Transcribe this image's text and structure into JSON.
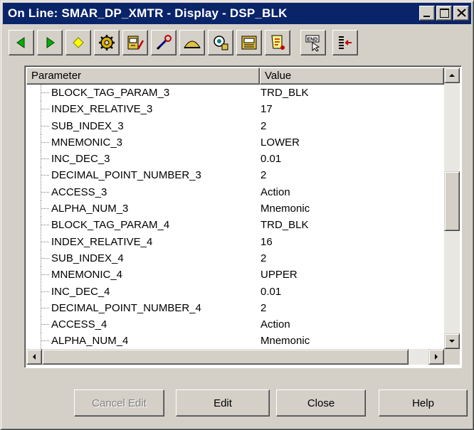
{
  "window": {
    "title": "On Line: SMAR_DP_XMTR - Display - DSP_BLK",
    "controls": [
      "minimize-icon",
      "maximize-icon",
      "close-icon"
    ]
  },
  "toolbar": {
    "buttons": [
      {
        "icon": "arrow-left-icon",
        "color": "#00a000"
      },
      {
        "icon": "arrow-right-icon",
        "color": "#00a000"
      },
      {
        "icon": "diamond-icon",
        "color": "#ffff00"
      },
      {
        "icon": "gears-icon"
      },
      {
        "icon": "calibrate-icon"
      },
      {
        "icon": "wrench-icon"
      },
      {
        "icon": "mountain-icon"
      },
      {
        "icon": "block-view-icon"
      },
      {
        "icon": "monitor-icon"
      },
      {
        "icon": "scroll-icon"
      },
      {
        "icon": "end-icon",
        "label": "END"
      },
      {
        "icon": "exit-list-icon"
      }
    ]
  },
  "table": {
    "columns": [
      "Parameter",
      "Value"
    ],
    "rows": [
      {
        "parameter": "BLOCK_TAG_PARAM_3",
        "value": "TRD_BLK"
      },
      {
        "parameter": "INDEX_RELATIVE_3",
        "value": "17"
      },
      {
        "parameter": "SUB_INDEX_3",
        "value": "2"
      },
      {
        "parameter": "MNEMONIC_3",
        "value": "LOWER"
      },
      {
        "parameter": "INC_DEC_3",
        "value": "0.01"
      },
      {
        "parameter": "DECIMAL_POINT_NUMBER_3",
        "value": "2"
      },
      {
        "parameter": "ACCESS_3",
        "value": "Action"
      },
      {
        "parameter": "ALPHA_NUM_3",
        "value": "Mnemonic"
      },
      {
        "parameter": "BLOCK_TAG_PARAM_4",
        "value": "TRD_BLK"
      },
      {
        "parameter": "INDEX_RELATIVE_4",
        "value": "16"
      },
      {
        "parameter": "SUB_INDEX_4",
        "value": "2"
      },
      {
        "parameter": "MNEMONIC_4",
        "value": "UPPER"
      },
      {
        "parameter": "INC_DEC_4",
        "value": "0.01"
      },
      {
        "parameter": "DECIMAL_POINT_NUMBER_4",
        "value": "2"
      },
      {
        "parameter": "ACCESS_4",
        "value": "Action"
      },
      {
        "parameter": "ALPHA_NUM_4",
        "value": "Mnemonic"
      }
    ]
  },
  "buttons": {
    "cancel_edit": "Cancel Edit",
    "edit": "Edit",
    "close": "Close",
    "help": "Help"
  },
  "colors": {
    "titlebar": "#0a246a",
    "face": "#d4d0c8"
  }
}
